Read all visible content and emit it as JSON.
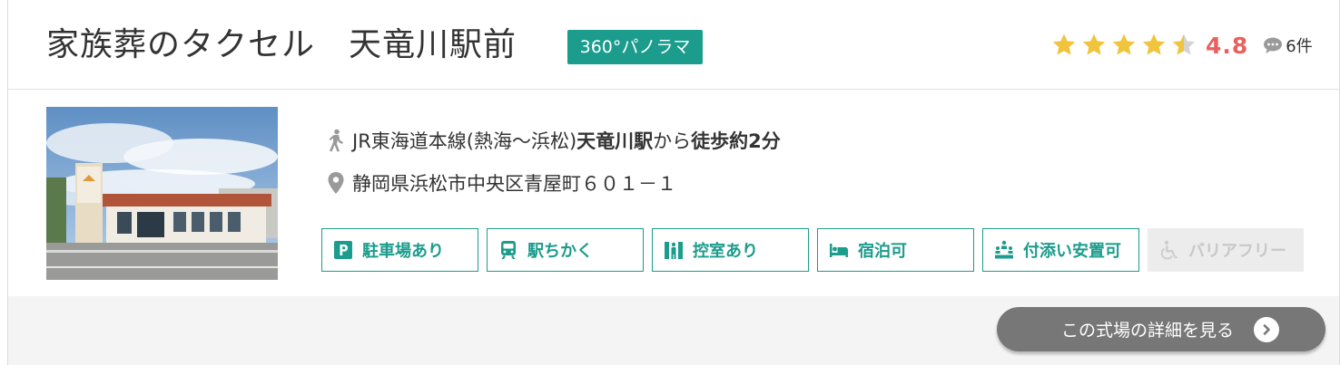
{
  "hall": {
    "name": "家族葬のタクセル　天竜川駅前",
    "panorama_badge": "360°パノラマ"
  },
  "rating": {
    "stars": 4.5,
    "value": "4.8",
    "review_count": "6件",
    "colors": {
      "star_filled": "#f0c43c",
      "star_empty": "#d4d4d4",
      "value": "#e8615f"
    }
  },
  "access": {
    "line": "JR東海道本線(熱海～浜松) ",
    "station": "天竜川駅",
    "from": "から",
    "walk": "徒歩約2分"
  },
  "address": "静岡県浜松市中央区青屋町６０１－１",
  "features": [
    {
      "label": "駐車場あり",
      "icon": "parking-icon",
      "enabled": true
    },
    {
      "label": "駅ちかく",
      "icon": "train-icon",
      "enabled": true
    },
    {
      "label": "控室あり",
      "icon": "waiting-room-icon",
      "enabled": true
    },
    {
      "label": "宿泊可",
      "icon": "bed-icon",
      "enabled": true
    },
    {
      "label": "付添い安置可",
      "icon": "attendance-icon",
      "enabled": true
    },
    {
      "label": "バリアフリー",
      "icon": "wheelchair-icon",
      "enabled": false
    }
  ],
  "detail_button": {
    "label": "この式場の詳細を見る",
    "icon": "chevron-right-icon"
  },
  "theme": {
    "accent": "#1b9c8c",
    "button_bg": "#777777",
    "footer_bg": "#f4f4f4"
  }
}
